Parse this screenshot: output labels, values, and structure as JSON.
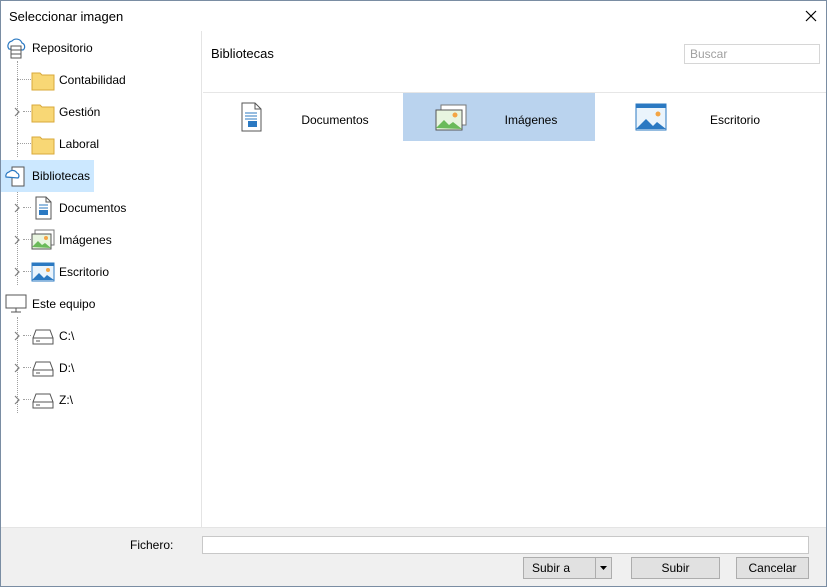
{
  "window": {
    "title": "Seleccionar imagen"
  },
  "tree": {
    "items": [
      {
        "label": "Repositorio",
        "icon": "cloud-repository-icon"
      },
      {
        "label": "Contabilidad",
        "icon": "folder-icon"
      },
      {
        "label": "Gestión",
        "icon": "folder-icon"
      },
      {
        "label": "Laboral",
        "icon": "folder-icon"
      },
      {
        "label": "Bibliotecas",
        "icon": "libraries-icon"
      },
      {
        "label": "Documentos",
        "icon": "document-icon"
      },
      {
        "label": "Imágenes",
        "icon": "pictures-icon"
      },
      {
        "label": "Escritorio",
        "icon": "desktop-icon"
      },
      {
        "label": "Este equipo",
        "icon": "computer-icon"
      },
      {
        "label": "C:\\",
        "icon": "drive-icon"
      },
      {
        "label": "D:\\",
        "icon": "drive-icon"
      },
      {
        "label": "Z:\\",
        "icon": "drive-icon"
      }
    ]
  },
  "content": {
    "title": "Bibliotecas",
    "search_placeholder": "Buscar",
    "libraries": [
      {
        "label": "Documentos",
        "icon": "document-icon"
      },
      {
        "label": "Imágenes",
        "icon": "pictures-icon",
        "selected": true
      },
      {
        "label": "Escritorio",
        "icon": "desktop-icon"
      }
    ]
  },
  "footer": {
    "file_label": "Fichero:",
    "file_value": "",
    "upload_to_label": "Subir a",
    "upload_label": "Subir",
    "cancel_label": "Cancelar"
  },
  "colors": {
    "selection": "#cce8ff",
    "selected_tile": "#bad3ee",
    "folder": "#f8d775",
    "accent_blue": "#2b79c2"
  }
}
